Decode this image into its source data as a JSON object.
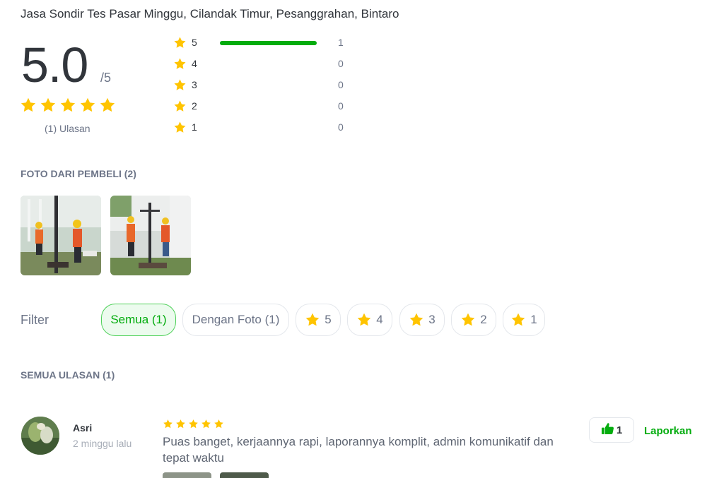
{
  "location_title": "Jasa Sondir Tes Pasar Minggu, Cilandak Timur, Pesanggrahan, Bintaro",
  "rating": {
    "score": "5.0",
    "max": "/5",
    "stars": 5,
    "review_count": "(1) Ulasan"
  },
  "distribution": [
    {
      "level": "5",
      "count": "1",
      "fraction": 1.0
    },
    {
      "level": "4",
      "count": "0",
      "fraction": 0
    },
    {
      "level": "3",
      "count": "0",
      "fraction": 0
    },
    {
      "level": "2",
      "count": "0",
      "fraction": 0
    },
    {
      "level": "1",
      "count": "0",
      "fraction": 0
    }
  ],
  "photos_section": {
    "heading": "FOTO DARI PEMBELI (2)",
    "photo_count": 2
  },
  "filter": {
    "label": "Filter",
    "chips": [
      {
        "label": "Semua (1)",
        "active": true
      },
      {
        "label": "Dengan Foto (1)",
        "active": false
      },
      {
        "label": "5",
        "star": true
      },
      {
        "label": "4",
        "star": true
      },
      {
        "label": "3",
        "star": true
      },
      {
        "label": "2",
        "star": true
      },
      {
        "label": "1",
        "star": true
      }
    ]
  },
  "reviews_section": {
    "heading": "SEMUA ULASAN (1)"
  },
  "review": {
    "name": "Asri",
    "time": "2 minggu lalu",
    "stars": 5,
    "text": "Puas banget, kerjaannya rapi, laporannya komplit, admin komunikatif dan tepat waktu",
    "like_count": "1",
    "report_label": "Laporkan"
  },
  "icons": {
    "star": "star-icon",
    "like": "thumbs-up-icon"
  },
  "colors": {
    "star": "#ffc400",
    "accent_green": "#03ac0e",
    "active_chip_bg": "#ecfbee",
    "text_primary": "#31353b",
    "text_secondary": "#6d7588"
  }
}
